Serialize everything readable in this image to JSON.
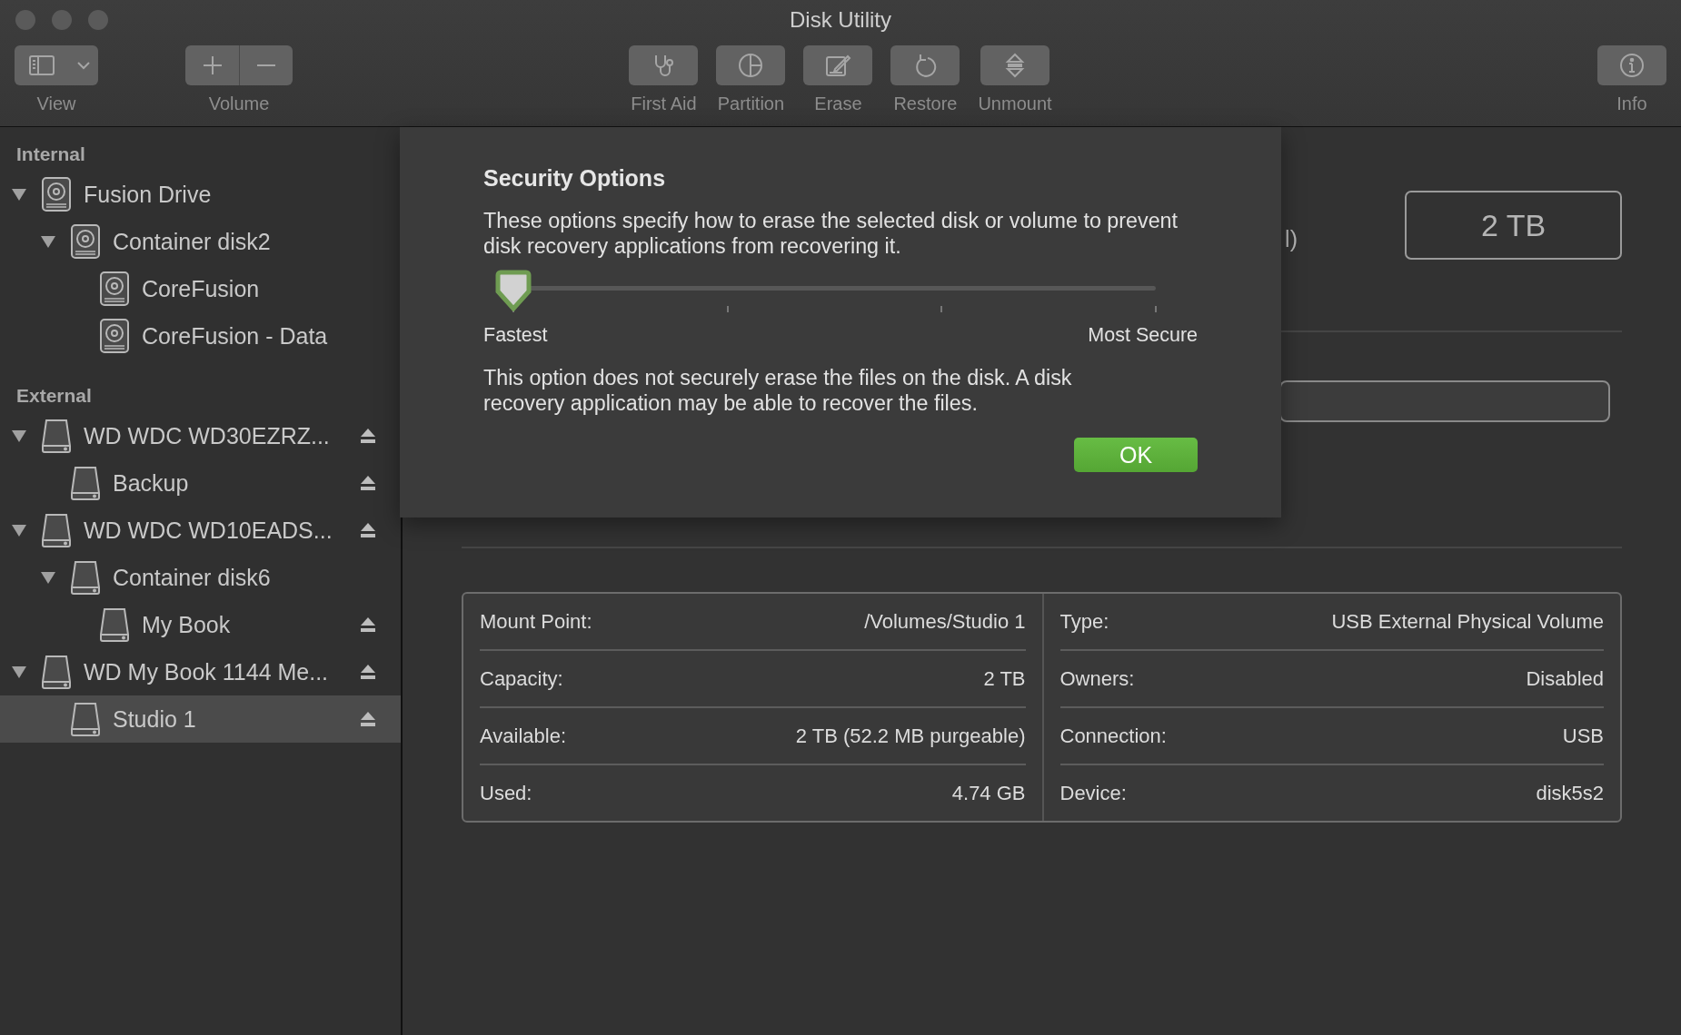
{
  "window": {
    "title": "Disk Utility"
  },
  "toolbar": [
    {
      "kind": "view",
      "label": "View"
    },
    {
      "kind": "volume",
      "label": "Volume"
    },
    {
      "kind": "first-aid",
      "label": "First Aid"
    },
    {
      "kind": "partition",
      "label": "Partition"
    },
    {
      "kind": "erase",
      "label": "Erase"
    },
    {
      "kind": "restore",
      "label": "Restore"
    },
    {
      "kind": "unmount",
      "label": "Unmount"
    },
    {
      "kind": "info",
      "label": "Info"
    }
  ],
  "sidebar": {
    "sections": [
      {
        "title": "Internal",
        "items": [
          {
            "name": "Fusion Drive",
            "kind": "fusion",
            "expanded": true,
            "ejectable": false,
            "selected": false,
            "children": [
              {
                "name": "Container disk2",
                "kind": "fusion",
                "expanded": true,
                "ejectable": false,
                "selected": false,
                "children": [
                  {
                    "name": "CoreFusion",
                    "kind": "fusion",
                    "ejectable": false,
                    "selected": false
                  },
                  {
                    "name": "CoreFusion - Data",
                    "kind": "fusion",
                    "ejectable": false,
                    "selected": false
                  }
                ]
              }
            ]
          }
        ]
      },
      {
        "title": "External",
        "items": [
          {
            "name": "WD WDC WD30EZRZ...",
            "kind": "external",
            "expanded": true,
            "ejectable": true,
            "selected": false,
            "children": [
              {
                "name": "Backup",
                "kind": "external",
                "ejectable": true,
                "selected": false
              }
            ]
          },
          {
            "name": "WD WDC WD10EADS...",
            "kind": "external",
            "expanded": true,
            "ejectable": true,
            "selected": false,
            "children": [
              {
                "name": "Container disk6",
                "kind": "external",
                "expanded": true,
                "ejectable": false,
                "selected": false,
                "children": [
                  {
                    "name": "My Book",
                    "kind": "external",
                    "ejectable": true,
                    "selected": false
                  }
                ]
              }
            ]
          },
          {
            "name": "WD My Book 1144 Me...",
            "kind": "external",
            "expanded": true,
            "ejectable": true,
            "selected": false,
            "children": [
              {
                "name": "Studio 1",
                "kind": "external",
                "ejectable": true,
                "selected": true
              }
            ]
          }
        ]
      }
    ]
  },
  "background": {
    "partial_text": "l)",
    "capacity": "2 TB"
  },
  "dialog": {
    "title": "Security Options",
    "description": "These options specify how to erase the selected disk or volume to prevent disk recovery applications from recovering it.",
    "slider": {
      "level": 0
    },
    "min_label": "Fastest",
    "max_label": "Most Secure",
    "note": "This option does not securely erase the files on the disk. A disk recovery application may be able to recover the files.",
    "button": "OK"
  },
  "info": {
    "left": [
      {
        "label": "Mount Point:",
        "value": "/Volumes/Studio 1"
      },
      {
        "label": "Capacity:",
        "value": "2 TB"
      },
      {
        "label": "Available:",
        "value": "2 TB (52.2 MB purgeable)"
      },
      {
        "label": "Used:",
        "value": "4.74 GB"
      }
    ],
    "right": [
      {
        "label": "Type:",
        "value": "USB External Physical Volume"
      },
      {
        "label": "Owners:",
        "value": "Disabled"
      },
      {
        "label": "Connection:",
        "value": "USB"
      },
      {
        "label": "Device:",
        "value": "disk5s2"
      }
    ]
  }
}
